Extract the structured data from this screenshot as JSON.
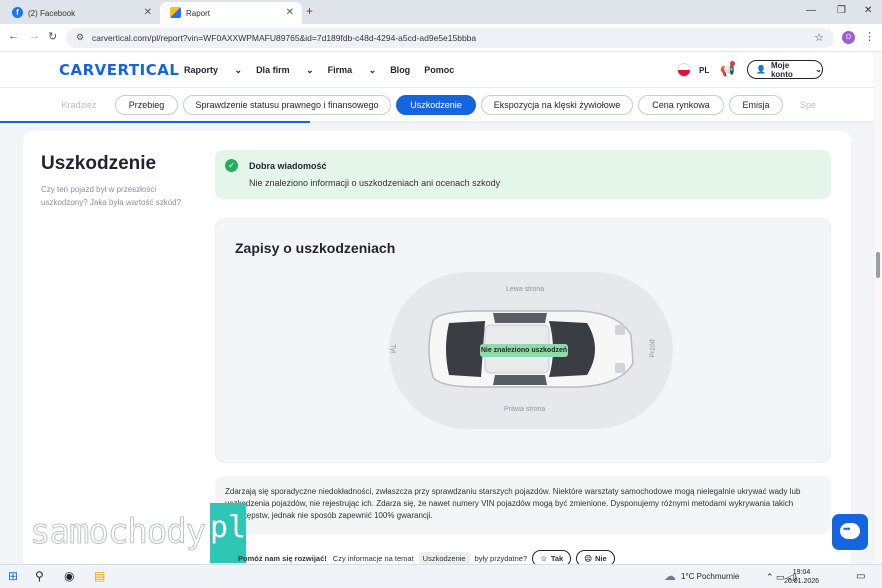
{
  "browser": {
    "tabs": [
      {
        "label": "(2) Facebook"
      },
      {
        "label": "Raport"
      }
    ],
    "url": "carvertical.com/pl/report?vin=WF0AXXWPMAFU89765&id=7d189fdb-c48d-4294-a5cd-ad9e5e15bbba",
    "profile_initial": "D"
  },
  "site": {
    "logo": "CARVERTICAL",
    "nav": [
      "Raporty",
      "Dla firm",
      "Firma",
      "Blog",
      "Pomoc"
    ],
    "lang": "PL",
    "account": "Moje konto"
  },
  "section_tabs": [
    "Kradzież",
    "Przebieg",
    "Sprawdzenie statusu prawnego i finansowego",
    "Uszkodzenie",
    "Ekspozycja na klęski żywiołowe",
    "Cena rynkowa",
    "Emisja",
    "Spe"
  ],
  "section": {
    "title": "Uszkodzenie",
    "subtitle": "Czy ten pojazd był w przeszłości uszkodzony? Jaka była wartość szkód?",
    "good_news_title": "Dobra wiadomość",
    "good_news_text": "Nie znaleziono informacji o uszkodzeniach ani ocenach szkody",
    "records_title": "Zapisy o uszkodzeniach",
    "label_left": "Lewa strona",
    "label_right": "Prawa strona",
    "label_front": "Przód",
    "label_rear": "Tył",
    "badge": "Nie znaleziono uszkodzeń",
    "disclaimer": "Zdarzają się sporadyczne niedokładności, zwłaszcza przy sprawdzaniu starszych pojazdów. Niektóre warsztaty samochodowe mogą nielegalnie ukrywać wady lub uszkodzenia pojazdów, nie rejestrując ich. Zdarza się, że nawet numery VIN pojazdów mogą być zmienione. Dysponujemy różnymi metodami wykrywania takich przestępstw, jednak nie sposób zapewnić 100% gwarancji."
  },
  "feedback": {
    "lead": "Pomóż nam się rozwijać!",
    "q1": "Czy informacje na temat",
    "keyword": "Uszkodzenie",
    "q2": "były przydatne?",
    "yes": "Tak",
    "no": "Nie"
  },
  "watermark": {
    "text": "samochody",
    "suffix": "pl"
  },
  "taskbar": {
    "weather": "1°C  Pochmurnie",
    "time": "19:04",
    "date": "26.01.2026"
  },
  "colors": {
    "accent": "#1565e0",
    "success": "#27ae60",
    "success_bg": "#e4f6e9"
  }
}
